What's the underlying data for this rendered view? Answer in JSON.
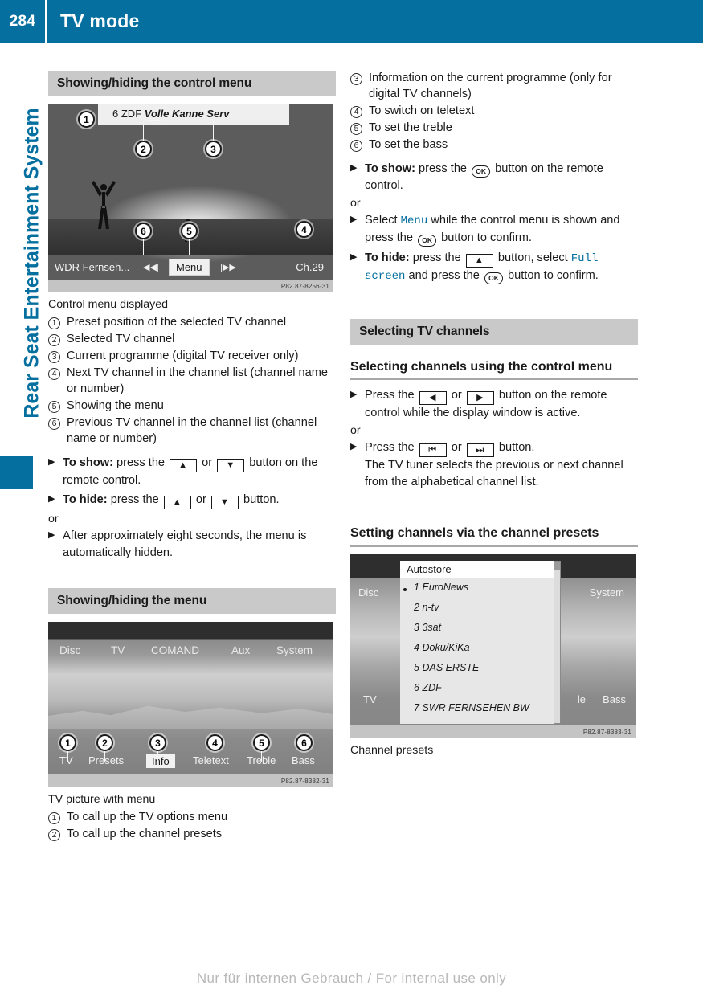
{
  "header": {
    "page_number": "284",
    "title": "TV mode"
  },
  "sidebar": {
    "label": "Rear Seat Entertainment System"
  },
  "left_column": {
    "section_title": "Showing/hiding the control menu",
    "figure1": {
      "topbar_preset": "6",
      "topbar_channel": "ZDF",
      "topbar_programme": "Volle Kanne Serv",
      "bottom_prev_channel": "WDR Fernseh...",
      "prev_icon": "skip-back-icon",
      "menu_label": "Menu",
      "next_icon": "skip-forward-icon",
      "bottom_right": "Ch.29",
      "code": "P82.87-8256-31",
      "callouts": [
        "1",
        "2",
        "3",
        "4",
        "5",
        "6"
      ]
    },
    "figure1_caption": "Control menu displayed",
    "numbered_items": [
      {
        "num": "1",
        "text": "Preset position of the selected TV channel"
      },
      {
        "num": "2",
        "text": "Selected TV channel"
      },
      {
        "num": "3",
        "text": "Current programme (digital TV receiver only)"
      },
      {
        "num": "4",
        "text": "Next TV channel in the channel list (channel name or number)"
      },
      {
        "num": "5",
        "text": "Showing the menu"
      },
      {
        "num": "6",
        "text": "Previous TV channel in the channel list (channel name or number)"
      }
    ],
    "instructions": [
      {
        "bold_lead": "To show:",
        "parts": [
          {
            "type": "text",
            "value": " press the "
          },
          {
            "type": "key",
            "value": "▲"
          },
          {
            "type": "text",
            "value": " or "
          },
          {
            "type": "key",
            "value": "▼"
          },
          {
            "type": "text",
            "value": " button on the remote control."
          }
        ]
      },
      {
        "bold_lead": "To hide:",
        "parts": [
          {
            "type": "text",
            "value": " press the "
          },
          {
            "type": "key",
            "value": "▲"
          },
          {
            "type": "text",
            "value": " or "
          },
          {
            "type": "key",
            "value": "▼"
          },
          {
            "type": "text",
            "value": " button."
          }
        ]
      }
    ],
    "or_word": "or",
    "final_instruction": "After approximately eight seconds, the menu is automatically hidden.",
    "section_title_2": "Showing/hiding the menu",
    "figure2": {
      "tabs": [
        "Disc",
        "TV",
        "COMAND",
        "Aux",
        "System"
      ],
      "selected_tab": "TV",
      "bottom_labels": [
        "TV",
        "Presets",
        "Info",
        "Teletext",
        "Treble",
        "Bass"
      ],
      "selected_bottom": "Info",
      "code": "P82.87-8382-31",
      "callouts": [
        "1",
        "2",
        "3",
        "4",
        "5",
        "6"
      ]
    },
    "figure2_caption": "TV picture with menu",
    "numbered_items_2": [
      {
        "num": "1",
        "text": "To call up the TV options menu"
      },
      {
        "num": "2",
        "text": "To call up the channel presets"
      }
    ]
  },
  "right_column": {
    "numbered_items": [
      {
        "num": "3",
        "text": "Information on the current programme (only for digital TV channels)"
      },
      {
        "num": "4",
        "text": "To switch on teletext"
      },
      {
        "num": "5",
        "text": "To set the treble"
      },
      {
        "num": "6",
        "text": "To set the bass"
      }
    ],
    "instr_show": {
      "bold_lead": "To show:",
      "parts": [
        {
          "type": "text",
          "value": " press the "
        },
        {
          "type": "ok",
          "value": "OK"
        },
        {
          "type": "text",
          "value": " button on the remote control."
        }
      ]
    },
    "or_word_1": "or",
    "instr_select": {
      "parts": [
        {
          "type": "text",
          "value": "Select "
        },
        {
          "type": "mono",
          "value": "Menu"
        },
        {
          "type": "text",
          "value": " while the control menu is shown and press the "
        },
        {
          "type": "ok",
          "value": "OK"
        },
        {
          "type": "text",
          "value": " button to confirm."
        }
      ]
    },
    "instr_hide": {
      "bold_lead": "To hide:",
      "parts": [
        {
          "type": "text",
          "value": " press the "
        },
        {
          "type": "key",
          "value": "▲"
        },
        {
          "type": "text",
          "value": " button, select "
        },
        {
          "type": "mono",
          "value": "Full screen"
        },
        {
          "type": "text",
          "value": " and press the "
        },
        {
          "type": "ok",
          "value": "OK"
        },
        {
          "type": "text",
          "value": " button to confirm."
        }
      ]
    },
    "section_title": "Selecting TV channels",
    "subhead_1": "Selecting channels using the control menu",
    "instr_press_lr": {
      "parts": [
        {
          "type": "text",
          "value": "Press the "
        },
        {
          "type": "key",
          "value": "◀"
        },
        {
          "type": "text",
          "value": " or "
        },
        {
          "type": "key",
          "value": "▶"
        },
        {
          "type": "text",
          "value": " button on the remote control while the display window is active."
        }
      ]
    },
    "or_word_2": "or",
    "instr_press_skip": {
      "parts": [
        {
          "type": "text",
          "value": "Press the "
        },
        {
          "type": "key",
          "value": "⏮"
        },
        {
          "type": "text",
          "value": " or "
        },
        {
          "type": "key",
          "value": "⏭"
        },
        {
          "type": "text",
          "value": " button."
        }
      ],
      "followup": "The TV tuner selects the previous or next channel from the alphabetical channel list."
    },
    "subhead_2": "Setting channels via the channel presets",
    "figure3": {
      "panel_title": "Autostore",
      "tab_disc": "Disc",
      "tab_tv": "TV",
      "tab_system": "System",
      "tab_le": "le",
      "tab_bass": "Bass",
      "presets": [
        {
          "index": "1",
          "name": "EuroNews",
          "selected": true
        },
        {
          "index": "2",
          "name": "n-tv",
          "selected": false
        },
        {
          "index": "3",
          "name": "3sat",
          "selected": false
        },
        {
          "index": "4",
          "name": "Doku/KiKa",
          "selected": false
        },
        {
          "index": "5",
          "name": "DAS ERSTE",
          "selected": false
        },
        {
          "index": "6",
          "name": "ZDF",
          "selected": false
        },
        {
          "index": "7",
          "name": "SWR FERNSEHEN BW",
          "selected": false
        }
      ],
      "code": "P82.87-8383-31"
    },
    "figure3_caption": "Channel presets"
  },
  "footer": {
    "text": "Nur für internen Gebrauch / For internal use only"
  },
  "colors": {
    "brand_blue": "#0570a0",
    "section_bar": "#c9c9c9",
    "footer_gray": "#b8b8b8"
  }
}
